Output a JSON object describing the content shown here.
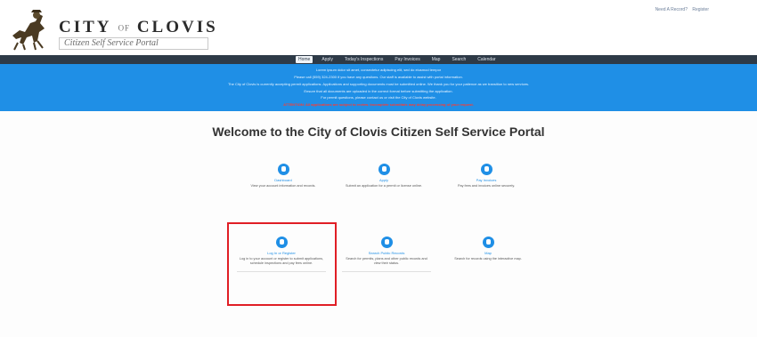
{
  "header": {
    "brand_city": "CITY",
    "brand_of": "OF",
    "brand_name": "CLOVIS",
    "brand_subtitle": "Citizen Self Service Portal",
    "top_links": [
      "Need A Record?",
      "Register"
    ]
  },
  "nav": {
    "items": [
      {
        "label": "Home",
        "active": true
      },
      {
        "label": "Apply",
        "active": false
      },
      {
        "label": "Today's Inspections",
        "active": false
      },
      {
        "label": "Pay Invoices",
        "active": false
      },
      {
        "label": "Map",
        "active": false
      },
      {
        "label": "Search",
        "active": false
      },
      {
        "label": "Calendar",
        "active": false
      }
    ]
  },
  "banner": {
    "lines": [
      "Lorem ipsum dolor sit amet, consectetur adipiscing elit, sed do eiusmod tempor",
      "Please call (559) 324-2300 if you have any questions. Our staff is available to assist with portal information.",
      "The City of Clovis is currently accepting permit applications. Applications and supporting documents must be submitted online. We thank you for your patience as we transition to new services.",
      "Ensure that all documents are uploaded in the correct format before submitting the application.",
      "For permit questions, please contact us or visit the City of Clovis website.",
      "ATTENTION: All applications are subject to review. Incomplete submittals may delay processing of your request."
    ]
  },
  "welcome": {
    "title": "Welcome to the City of Clovis Citizen Self Service Portal"
  },
  "tiles": [
    {
      "label": "Dashboard",
      "icon": "dashboard-icon",
      "desc": "View your account information and records."
    },
    {
      "label": "Apply",
      "icon": "apply-icon",
      "desc": "Submit an application for a permit or license online."
    },
    {
      "label": "Pay Invoices",
      "icon": "pay-icon",
      "desc": "Pay fees and invoices online securely."
    },
    {
      "label": "Log In or Register",
      "icon": "login-icon",
      "desc": "Log in to your account or register to submit applications, schedule inspections and pay fees online."
    },
    {
      "label": "Search Public Records",
      "icon": "search-icon",
      "desc": "Search for permits, plans and other public records and view their status."
    },
    {
      "label": "Map",
      "icon": "map-icon",
      "desc": "Search for records using the interactive map."
    }
  ],
  "colors": {
    "accent_blue": "#1f8fe6",
    "nav_dark": "#2e3a47",
    "highlight_red": "#e01e25"
  }
}
